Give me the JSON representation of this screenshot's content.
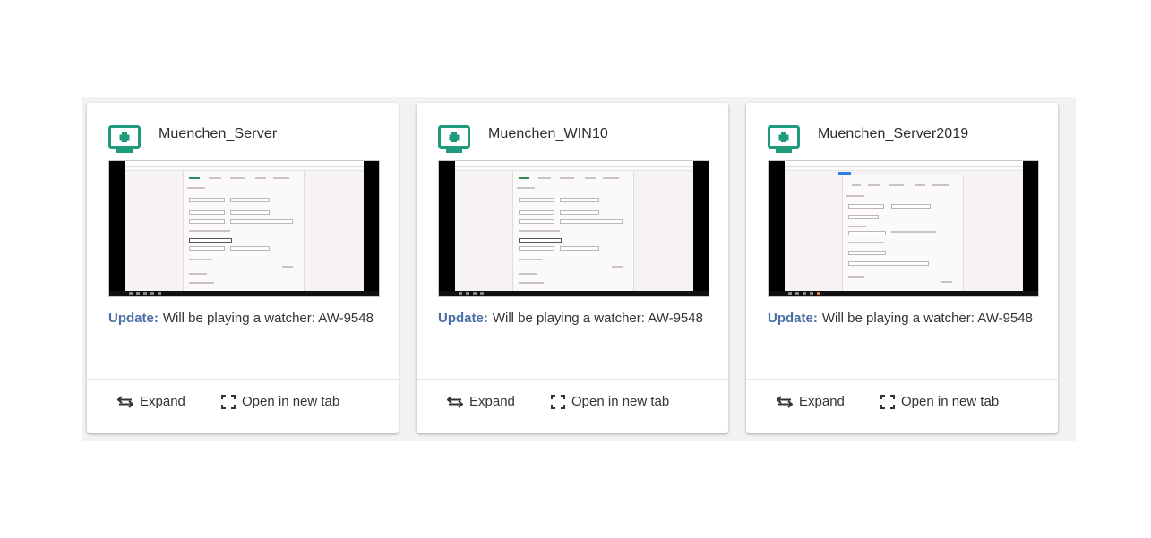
{
  "cards": [
    {
      "title": "Muenchen_Server",
      "update_label": "Update:",
      "update_text": "Will be playing a watcher: AW-9548",
      "expand_label": "Expand",
      "newtab_label": "Open in new tab"
    },
    {
      "title": "Muenchen_WIN10",
      "update_label": "Update:",
      "update_text": "Will be playing a watcher: AW-9548",
      "expand_label": "Expand",
      "newtab_label": "Open in new tab"
    },
    {
      "title": "Muenchen_Server2019",
      "update_label": "Update:",
      "update_text": "Will be playing a watcher: AW-9548",
      "expand_label": "Expand",
      "newtab_label": "Open in new tab"
    }
  ],
  "colors": {
    "monitor_icon": "#1e9a7c",
    "update_label": "#4a6fa5",
    "panel_background": "#f2f2f2"
  },
  "icons": {
    "machine": "monitor-plus-icon",
    "expand": "swap-arrows-icon",
    "newtab": "fullscreen-corners-icon"
  }
}
